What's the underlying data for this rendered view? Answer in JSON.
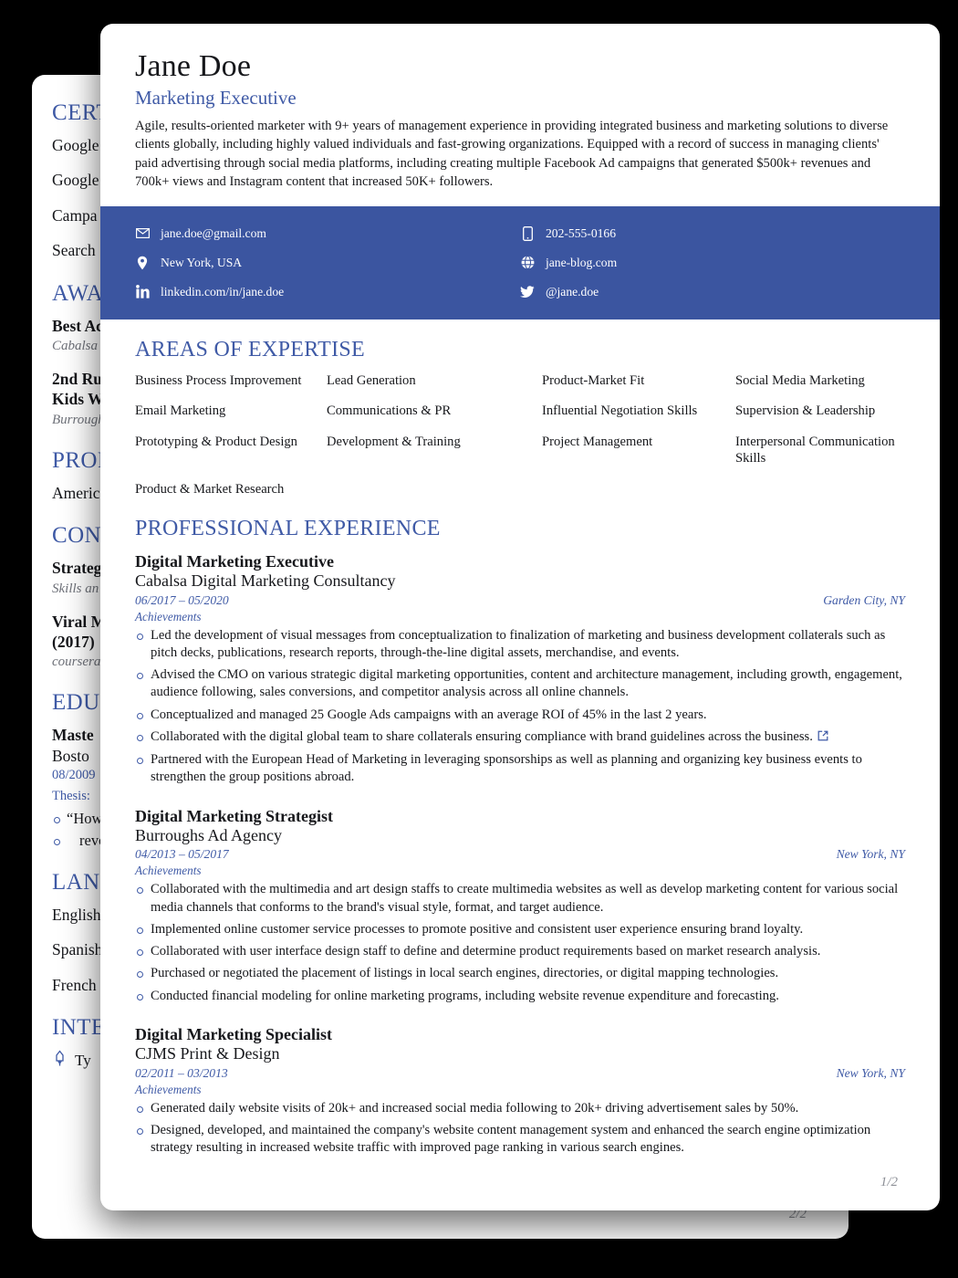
{
  "document": {
    "page_label_front": "1/2",
    "page_label_back": "2/2"
  },
  "colors": {
    "accent_blue": "#3f5aa6",
    "bar_blue": "#3b55a0",
    "text_dark": "#16171b",
    "muted_gray": "#8d9097"
  },
  "header": {
    "name": "Jane Doe",
    "role": "Marketing Executive",
    "summary": "Agile, results-oriented marketer with 9+ years of management experience in providing integrated business and marketing solutions to diverse clients globally, including highly valued individuals and fast-growing organizations. Equipped with a record of success in managing clients' paid advertising through social media platforms, including creating multiple Facebook Ad campaigns that generated $500k+ revenues and 700k+ views and Instagram content that increased 50K+ followers."
  },
  "contact": {
    "left": [
      {
        "icon": "envelope-icon",
        "value": "jane.doe@gmail.com"
      },
      {
        "icon": "location-pin-icon",
        "value": "New York, USA"
      },
      {
        "icon": "linkedin-icon",
        "value": "linkedin.com/in/jane.doe"
      }
    ],
    "right": [
      {
        "icon": "mobile-phone-icon",
        "value": "202-555-0166"
      },
      {
        "icon": "globe-icon",
        "value": "jane-blog.com"
      },
      {
        "icon": "twitter-icon",
        "value": "@jane.doe"
      }
    ]
  },
  "expertise": {
    "heading": "AREAS OF EXPERTISE",
    "items": [
      "Business Process Improvement",
      "Lead Generation",
      "Product-Market Fit",
      "Social Media Marketing",
      "Email Marketing",
      "Communications & PR",
      "Influential Negotiation Skills",
      "Supervision & Leadership",
      "Prototyping & Product Design",
      "Development & Training",
      "Project Management",
      "Interpersonal Communication Skills",
      "Product & Market Research"
    ]
  },
  "experience": {
    "heading": "PROFESSIONAL EXPERIENCE",
    "achievements_label": "Achievements",
    "jobs": [
      {
        "title": "Digital Marketing Executive",
        "company": "Cabalsa Digital Marketing Consultancy",
        "dates": "06/2017 – 05/2020",
        "location": "Garden City, NY",
        "bullets": [
          {
            "text": "Led the development of visual messages from conceptualization to finalization of marketing and business development collaterals such as pitch decks, publications, research reports, through-the-line digital assets, merchandise, and events.",
            "link": false
          },
          {
            "text": "Advised the CMO on various strategic digital marketing opportunities, content and architecture management, including growth, engagement, audience following, sales conversions, and competitor analysis across all online channels.",
            "link": false
          },
          {
            "text": "Conceptualized and managed 25 Google Ads campaigns with an average ROI of 45% in the last 2 years.",
            "link": false
          },
          {
            "text": "Collaborated with the digital global team to share collaterals ensuring compliance with brand guidelines across the business.",
            "link": true
          },
          {
            "text": "Partnered with the European Head of Marketing in leveraging sponsorships as well as planning and organizing key business events to strengthen the group positions abroad.",
            "link": false
          }
        ]
      },
      {
        "title": "Digital Marketing Strategist",
        "company": "Burroughs Ad Agency",
        "dates": "04/2013 – 05/2017",
        "location": "New York, NY",
        "bullets": [
          {
            "text": "Collaborated with the multimedia and art design staffs to create multimedia websites as well as develop marketing content for various social media channels that conforms to the brand's visual style, format, and target audience.",
            "link": false
          },
          {
            "text": "Implemented online customer service processes to promote positive and consistent user experience ensuring brand loyalty.",
            "link": false
          },
          {
            "text": "Collaborated with user interface design staff to define and determine product requirements based on market research analysis.",
            "link": false
          },
          {
            "text": "Purchased or negotiated the placement of listings in local search engines, directories, or digital mapping technologies.",
            "link": false
          },
          {
            "text": "Conducted financial modeling for online marketing programs, including website revenue expenditure and forecasting.",
            "link": false
          }
        ]
      },
      {
        "title": "Digital Marketing Specialist",
        "company": "CJMS Print & Design",
        "dates": "02/2011 – 03/2013",
        "location": "New York, NY",
        "bullets": [
          {
            "text": "Generated daily website visits of 20k+ and increased social media following to 20k+ driving advertisement sales by 50%.",
            "link": false
          },
          {
            "text": "Designed, developed, and maintained the company's website content management system and enhanced the search engine optimization strategy resulting in increased website traffic with improved page ranking in various search engines.",
            "link": false
          }
        ]
      }
    ]
  },
  "back_page": {
    "sections": [
      {
        "heading": "CERTIFICATES",
        "entries": [
          {
            "line": "Google",
            "bold": false
          },
          {
            "line": "Google",
            "bold": false
          },
          {
            "line": "Campa",
            "bold": false
          },
          {
            "line": "Search",
            "bold": false
          }
        ]
      },
      {
        "heading": "AWARDS",
        "entries": [
          {
            "line": "Best Ac",
            "bold": true,
            "sub": "Cabalsa"
          },
          {
            "line": "2nd Ru",
            "bold": true,
            "line2": "Kids W",
            "sub": "Burrough"
          }
        ]
      },
      {
        "heading": "PROFESSIONAL MEMBERSHIPS",
        "entries": [
          {
            "line": "Americ",
            "bold": false
          }
        ]
      },
      {
        "heading": "CONFERENCES & COURSES",
        "entries": [
          {
            "line": "Strateg",
            "bold": true,
            "sub": "Skills an"
          },
          {
            "line": "Viral M",
            "bold": true,
            "line2": "(2017)",
            "sub": "coursera"
          }
        ]
      },
      {
        "heading": "EDUCATION",
        "entries": [
          {
            "line": "Maste",
            "bold": true,
            "line2": "Bosto",
            "meta": "08/2009",
            "meta2": "Thesis:",
            "bullets": [
              "“How",
              "revolu"
            ]
          }
        ]
      },
      {
        "heading": "LANGUAGES",
        "entries": [
          {
            "line": "English",
            "bold": false
          },
          {
            "line": "Spanish",
            "bold": false
          },
          {
            "line": "French",
            "bold": false
          }
        ]
      },
      {
        "heading": "INTERESTS",
        "entries": [
          {
            "line": "Ty",
            "bold": false,
            "icon": "fountain-pen-icon"
          }
        ]
      }
    ]
  }
}
